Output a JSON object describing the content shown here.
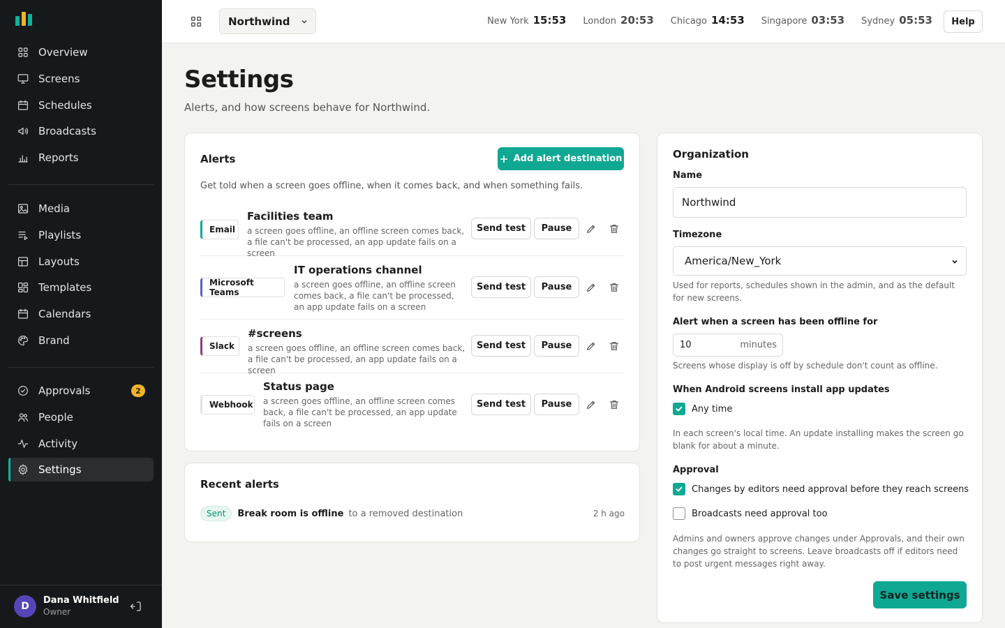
{
  "brand": {
    "accent": "#10a893",
    "sidebar_bg": "#16191b"
  },
  "sidebar": {
    "groups": [
      [
        {
          "label": "Overview",
          "icon": "grid-icon"
        },
        {
          "label": "Screens",
          "icon": "monitor-icon"
        },
        {
          "label": "Schedules",
          "icon": "calendar-icon"
        },
        {
          "label": "Broadcasts",
          "icon": "speaker-icon"
        },
        {
          "label": "Reports",
          "icon": "bar-chart-icon"
        }
      ],
      [
        {
          "label": "Media",
          "icon": "image-icon"
        },
        {
          "label": "Playlists",
          "icon": "playlist-icon"
        },
        {
          "label": "Layouts",
          "icon": "layout-icon"
        },
        {
          "label": "Templates",
          "icon": "templates-icon"
        },
        {
          "label": "Calendars",
          "icon": "calendar-icon"
        },
        {
          "label": "Brand",
          "icon": "palette-icon"
        }
      ],
      [
        {
          "label": "Approvals",
          "icon": "check-circle-icon",
          "badge": "2"
        },
        {
          "label": "People",
          "icon": "people-icon"
        },
        {
          "label": "Activity",
          "icon": "activity-icon"
        },
        {
          "label": "Settings",
          "icon": "gear-icon",
          "active": true
        }
      ]
    ],
    "user": {
      "initial": "D",
      "name": "Dana Whitfield",
      "role": "Owner"
    }
  },
  "topbar": {
    "org": "Northwind",
    "clocks": [
      {
        "city": "New York",
        "time": "15:53"
      },
      {
        "city": "London",
        "time": "20:53"
      },
      {
        "city": "Chicago",
        "time": "14:53"
      },
      {
        "city": "Singapore",
        "time": "03:53"
      },
      {
        "city": "Sydney",
        "time": "05:53"
      }
    ],
    "help": "Help"
  },
  "page": {
    "title": "Settings",
    "subtitle": "Alerts, and how screens behave for Northwind."
  },
  "alerts": {
    "title": "Alerts",
    "add_label": "Add alert destination",
    "description": "Get told when a screen goes offline, when it comes back, and when something fails.",
    "send_test": "Send test",
    "pause": "Pause",
    "destinations": [
      {
        "type": "Email",
        "color": "#10a893",
        "name": "Facilities team",
        "desc": "a screen goes offline, an offline screen comes back, a file can't be processed, an app update fails on a screen"
      },
      {
        "type": "Microsoft Teams",
        "color": "#5b5fc7",
        "name": "IT operations channel",
        "desc": "a screen goes offline, an offline screen comes back, a file can't be processed, an app update fails on a screen"
      },
      {
        "type": "Slack",
        "color": "#8a3d7d",
        "name": "#screens",
        "desc": "a screen goes offline, an offline screen comes back, a file can't be processed, an app update fails on a screen"
      },
      {
        "type": "Webhook",
        "color": "#e3e3df",
        "name": "Status page",
        "desc": "a screen goes offline, an offline screen comes back, a file can't be processed, an app update fails on a screen"
      }
    ]
  },
  "recent": {
    "title": "Recent alerts",
    "items": [
      {
        "status": "Sent",
        "title": "Break room is offline",
        "note": "to a removed destination",
        "time": "2 h ago"
      }
    ]
  },
  "organization": {
    "title": "Organization",
    "name_label": "Name",
    "name_value": "Northwind",
    "timezone_label": "Timezone",
    "timezone_value": "America/New_York",
    "timezone_help": "Used for reports, schedules shown in the admin, and as the default for new screens.",
    "offline_label": "Alert when a screen has been offline for",
    "offline_value": "10",
    "offline_unit": "minutes",
    "offline_help": "Screens whose display is off by schedule don't count as offline.",
    "updates_label": "When Android screens install app updates",
    "updates_option": "Any time",
    "updates_help": "In each screen's local time. An update installing makes the screen go blank for about a minute.",
    "approval_label": "Approval",
    "approval_option_1": "Changes by editors need approval before they reach screens",
    "approval_option_2": "Broadcasts need approval too",
    "approval_help": "Admins and owners approve changes under Approvals, and their own changes go straight to screens. Leave broadcasts off if editors need to post urgent messages right away.",
    "save_label": "Save settings"
  }
}
